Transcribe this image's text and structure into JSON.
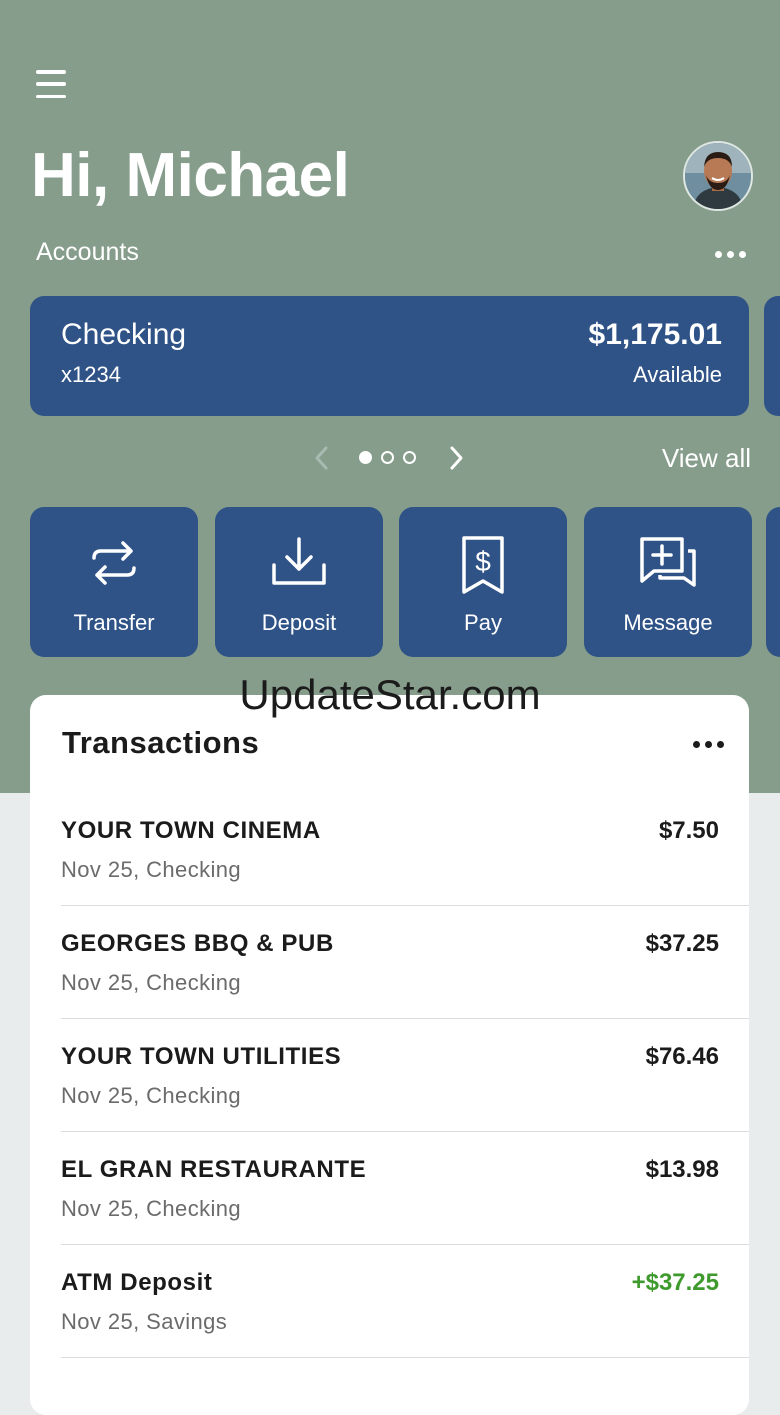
{
  "colors": {
    "header_bg": "#869d8c",
    "card_blue": "#2f5386",
    "page_bg": "#e9ecec",
    "credit_green": "#3f9a2e"
  },
  "header": {
    "menu_icon": "hamburger-menu-icon",
    "greeting": "Hi, Michael",
    "avatar_icon": "user-avatar"
  },
  "accounts": {
    "label": "Accounts",
    "more_icon": "more-horizontal-icon",
    "card": {
      "name": "Checking",
      "number": "x1234",
      "balance": "$1,175.01",
      "balance_label": "Available"
    },
    "pager": {
      "total": 3,
      "current": 1
    },
    "view_all": "View all"
  },
  "actions": [
    {
      "label": "Transfer",
      "icon": "transfer-arrows-icon"
    },
    {
      "label": "Deposit",
      "icon": "download-tray-icon"
    },
    {
      "label": "Pay",
      "icon": "dollar-receipt-icon"
    },
    {
      "label": "Message",
      "icon": "message-plus-icon"
    }
  ],
  "watermark": "UpdateStar.com",
  "transactions": {
    "title": "Transactions",
    "more_icon": "more-horizontal-icon",
    "items": [
      {
        "name": "YOUR TOWN CINEMA",
        "meta": "Nov 25, Checking",
        "amount": "$7.50"
      },
      {
        "name": "GEORGES BBQ & PUB",
        "meta": "Nov 25, Checking",
        "amount": "$37.25"
      },
      {
        "name": "YOUR TOWN UTILITIES",
        "meta": "Nov 25, Checking",
        "amount": "$76.46"
      },
      {
        "name": "EL GRAN RESTAURANTE",
        "meta": "Nov 25, Checking",
        "amount": "$13.98"
      },
      {
        "name": "ATM Deposit",
        "meta": "Nov 25, Savings",
        "amount": "+$37.25",
        "credit": true
      }
    ]
  }
}
